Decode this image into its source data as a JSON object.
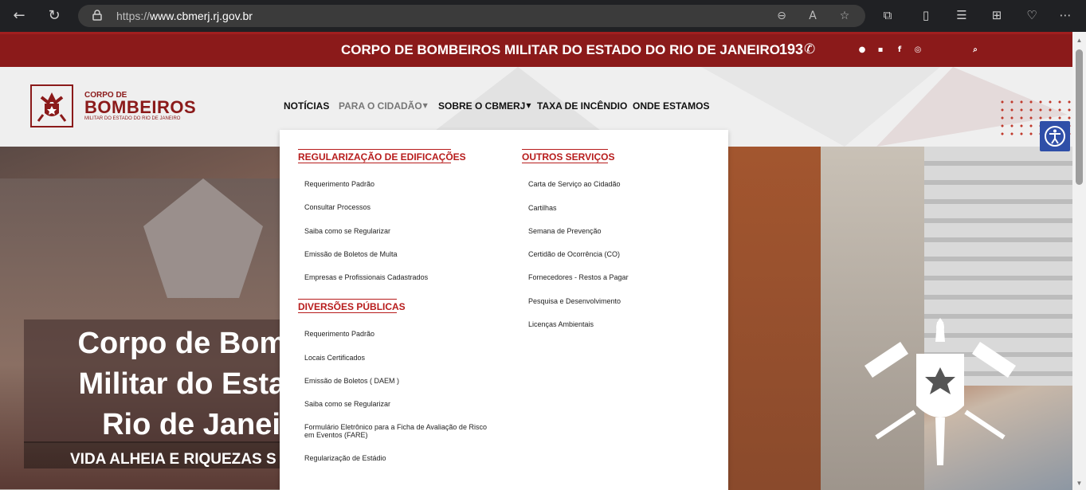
{
  "browser": {
    "url_prefix": "https://",
    "url_host": "www.cbmerj.rj.gov.br",
    "icons": [
      "back-icon",
      "refresh-icon",
      "lock-icon",
      "zoom-icon",
      "read-aloud-icon",
      "favorite-star-icon",
      "extensions-icon",
      "split-screen-icon",
      "favorites-icon",
      "collections-icon",
      "health-icon",
      "more-icon"
    ]
  },
  "topbar": {
    "org_name": "CORPO DE BOMBEIROS MILITAR DO ESTADO DO RIO DE JANEIRO",
    "phone": "193"
  },
  "logo": {
    "line1": "CORPO DE",
    "line2": "BOMBEIROS",
    "line3": "MILITAR DO ESTADO DO RIO DE JANEIRO"
  },
  "nav": {
    "items": [
      {
        "label": "NOTÍCIAS"
      },
      {
        "label": "PARA O CIDADÃO"
      },
      {
        "label": "SOBRE O CBMERJ"
      },
      {
        "label": "TAXA DE INCÊNDIO"
      },
      {
        "label": "ONDE ESTAMOS"
      }
    ]
  },
  "dropdown": {
    "left": {
      "heading1": "REGULARIZAÇÃO DE EDIFICAÇÕES",
      "items1": [
        "Requerimento Padrão",
        "Consultar Processos",
        "Saiba como se Regularizar",
        "Emissão de Boletos de Multa",
        "Empresas e Profissionais Cadastrados"
      ],
      "heading2": "DIVERSÕES PÚBLICAS",
      "items2": [
        "Requerimento Padrão",
        "Locais Certificados",
        "Emissão de Boletos ( DAEM )",
        "Saiba como se Regularizar",
        "Formulário Eletrônico para a Ficha de Avaliação de Risco",
        "em Eventos (FARE)",
        "Regularização de Estádio"
      ]
    },
    "right": {
      "heading": "OUTROS SERVIÇOS",
      "items": [
        "Carta de Serviço ao Cidadão",
        "Cartilhas",
        "Semana de Prevenção",
        "Certidão de Ocorrência (CO)",
        "Fornecedores - Restos a Pagar",
        "Pesquisa e Desenvolvimento",
        "Licenças Ambientais"
      ]
    }
  },
  "hero": {
    "title_lines": [
      "Corpo de Bomb",
      "Militar do Estad",
      "Rio de Janei"
    ],
    "subtitle": "VIDA ALHEIA E RIQUEZAS S"
  },
  "colors": {
    "brand_red": "#8b1a1a",
    "heading_red": "#b71c1c",
    "access_blue": "#2f4fa8"
  }
}
